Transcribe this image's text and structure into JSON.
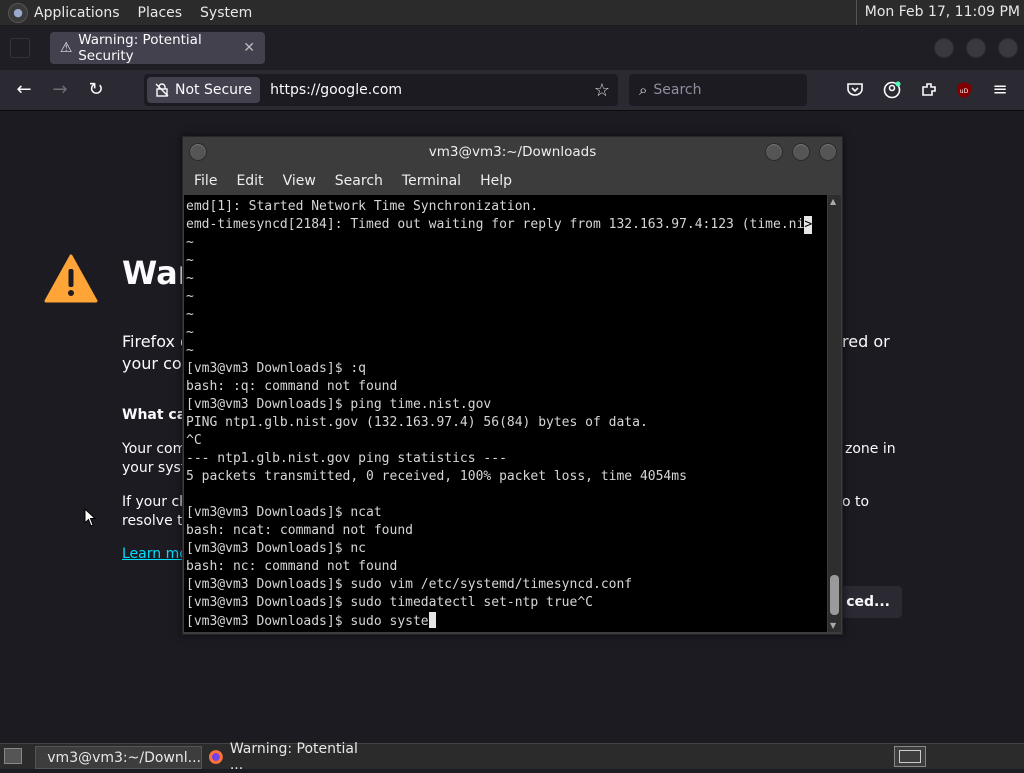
{
  "top_panel": {
    "menus": [
      "Applications",
      "Places",
      "System"
    ],
    "clock": "Mon Feb 17, 11:09 PM"
  },
  "firefox": {
    "tab": {
      "title": "Warning: Potential Security",
      "close": "✕"
    },
    "nav": {
      "security_label": "Not Secure",
      "url": "https://google.com",
      "search_placeholder": "Search"
    },
    "content": {
      "title": "War",
      "para1_line1": "Firefox d",
      "para1_line1_right": "red or",
      "para1_line2": "your com",
      "what_heading": "What ca",
      "p2_line1": "Your com",
      "p2_line1_right": "zone in",
      "p2_line2": "your syst",
      "p3_line1": "If your clo",
      "p3_line1_right": "o to",
      "p3_line2": "resolve th",
      "learn_more": "Learn mo",
      "advanced_button": "ced..."
    }
  },
  "terminal": {
    "title": "vm3@vm3:~/Downloads",
    "menu": [
      "File",
      "Edit",
      "View",
      "Search",
      "Terminal",
      "Help"
    ],
    "lines": [
      "emd[1]: Started Network Time Synchronization.",
      "emd-timesyncd[2184]: Timed out waiting for reply from 132.163.97.4:123 (time.ni",
      "~",
      "~",
      "~",
      "~",
      "~",
      "~",
      "~",
      "[vm3@vm3 Downloads]$ :q",
      "bash: :q: command not found",
      "[vm3@vm3 Downloads]$ ping time.nist.gov",
      "PING ntp1.glb.nist.gov (132.163.97.4) 56(84) bytes of data.",
      "^C",
      "--- ntp1.glb.nist.gov ping statistics ---",
      "5 packets transmitted, 0 received, 100% packet loss, time 4054ms",
      "",
      "[vm3@vm3 Downloads]$ ncat",
      "bash: ncat: command not found",
      "[vm3@vm3 Downloads]$ nc",
      "bash: nc: command not found",
      "[vm3@vm3 Downloads]$ sudo vim /etc/systemd/timesyncd.conf",
      "[vm3@vm3 Downloads]$ sudo timedatectl set-ntp true^C",
      "[vm3@vm3 Downloads]$ sudo syste"
    ],
    "truncation_marker": ">"
  },
  "taskbar": {
    "tasks": [
      "vm3@vm3:~/Downl...",
      "Warning: Potential ..."
    ]
  }
}
